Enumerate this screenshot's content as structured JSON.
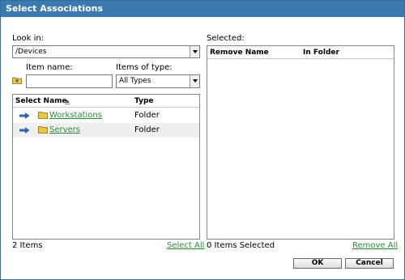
{
  "dialog": {
    "title": "Select Associations"
  },
  "left": {
    "look_in_label": "Look in:",
    "look_in_value": "/Devices",
    "item_name_label": "Item name:",
    "item_name_value": "",
    "items_of_type_label": "Items of type:",
    "items_of_type_value": "All Types",
    "columns": {
      "name": "Select Name",
      "type": "Type"
    },
    "rows": [
      {
        "name": "Workstations",
        "type": "Folder"
      },
      {
        "name": "Servers",
        "type": "Folder"
      }
    ],
    "count_text": "2 Items",
    "select_all": "Select All"
  },
  "right": {
    "selected_label": "Selected:",
    "columns": {
      "remove": "Remove Name",
      "folder": "In Folder"
    },
    "count_text": "0 Items Selected",
    "remove_all": "Remove All"
  },
  "buttons": {
    "ok": "OK",
    "cancel": "Cancel"
  },
  "colors": {
    "titlebar": "#3b79ae",
    "link": "#2a8a3a",
    "arrow": "#2f5fb0",
    "folder": "#e8c840"
  },
  "icons": [
    "sort-ascending-icon",
    "folder-up-icon",
    "arrow-right-icon",
    "folder-icon",
    "chevron-down-icon"
  ]
}
